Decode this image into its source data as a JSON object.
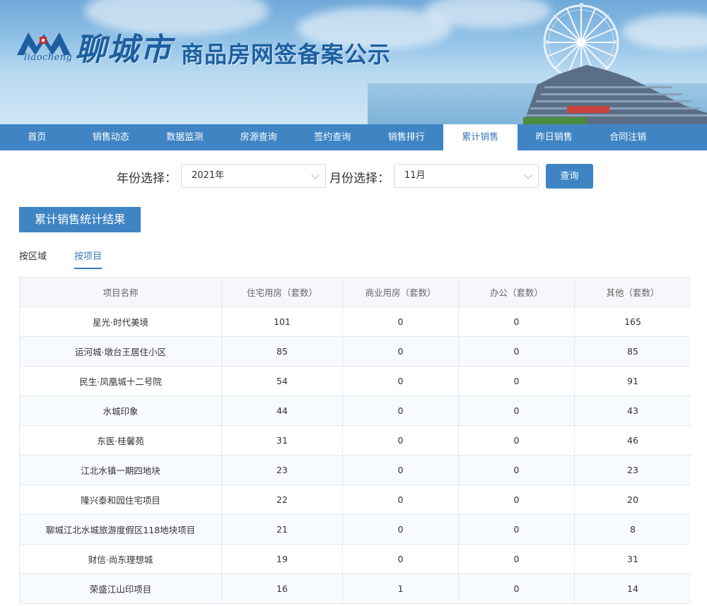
{
  "header": {
    "logo_sub": "liaocheng",
    "city": "聊城市",
    "title": "商品房网签备案公示"
  },
  "nav": {
    "items": [
      "首页",
      "销售动态",
      "数据监测",
      "房源查询",
      "签约查询",
      "销售排行",
      "累计销售",
      "昨日销售",
      "合同注销"
    ],
    "active_index": 6
  },
  "filter": {
    "year_label": "年份选择：",
    "year_value": "2021年",
    "month_label": "月份选择：",
    "month_value": "11月",
    "query_label": "查询"
  },
  "section": {
    "title": "累计销售统计结果"
  },
  "subtabs": {
    "by_region": "按区域",
    "by_project": "按项目",
    "active": "by_project"
  },
  "table": {
    "headers": [
      "项目名称",
      "住宅用房（套数）",
      "商业用房（套数）",
      "办公（套数）",
      "其他（套数）"
    ],
    "rows": [
      [
        "星光·时代美境",
        "101",
        "0",
        "0",
        "165"
      ],
      [
        "运河城·墩台王居住小区",
        "85",
        "0",
        "0",
        "85"
      ],
      [
        "民生·凤凰城十二号院",
        "54",
        "0",
        "0",
        "91"
      ],
      [
        "水城印象",
        "44",
        "0",
        "0",
        "43"
      ],
      [
        "东医·桂馨苑",
        "31",
        "0",
        "0",
        "46"
      ],
      [
        "江北水镇一期四地块",
        "23",
        "0",
        "0",
        "23"
      ],
      [
        "隆兴泰和园住宅项目",
        "22",
        "0",
        "0",
        "20"
      ],
      [
        "聊城江北水城旅游度假区118地块项目",
        "21",
        "0",
        "0",
        "8"
      ],
      [
        "财信·尚东理想城",
        "19",
        "0",
        "0",
        "31"
      ],
      [
        "荣盛江山印项目",
        "16",
        "1",
        "0",
        "14"
      ]
    ]
  },
  "colors": {
    "nav_bg": "#3f85c4",
    "accent": "#3a7bbf",
    "logo": "#1d5fa0"
  }
}
